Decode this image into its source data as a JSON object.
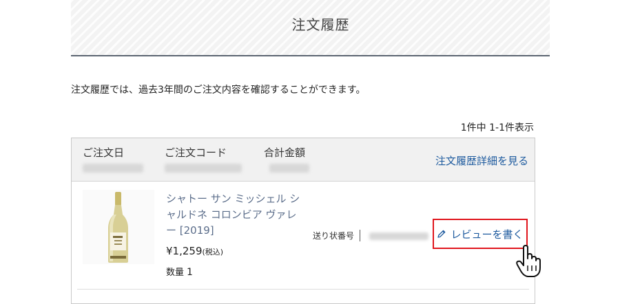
{
  "page": {
    "title": "注文履歴",
    "intro": "注文履歴では、過去3年間のご注文内容を確認することができます。",
    "result_count": "1件中 1-1件表示"
  },
  "order": {
    "date_label": "ご注文日",
    "code_label": "ご注文コード",
    "total_label": "合計金額",
    "detail_link": "注文履歴詳細を見る"
  },
  "item": {
    "name": "シャトー サン ミッシェル シャルドネ コロンビア ヴァレー [2019]",
    "price": "¥1,259",
    "price_suffix": "(税込)",
    "qty_label": "数量",
    "qty_value": "1",
    "tracking_label": "送り状番号",
    "review_button": "レビューを書く"
  },
  "colors": {
    "accent_link": "#1d5a9e",
    "highlight_border": "#e0141b"
  },
  "icons": [
    "pencil-icon",
    "hand-pointer-icon"
  ]
}
